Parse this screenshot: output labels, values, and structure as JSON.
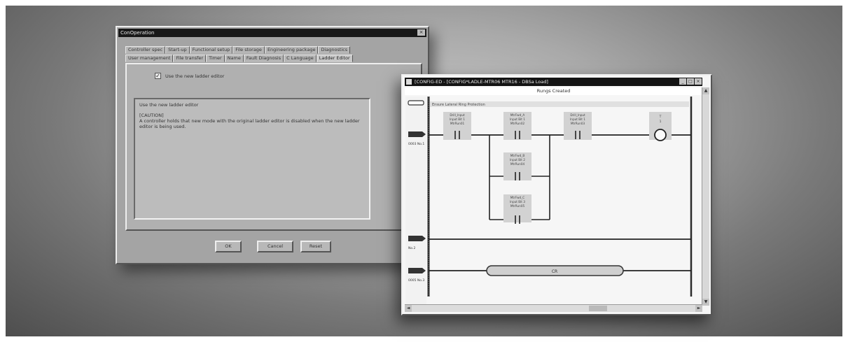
{
  "config_dialog": {
    "title": "ConOperation",
    "close_glyph": "×",
    "tabs_row1": [
      "Controller spec",
      "Start-up",
      "Functional setup",
      "File storage",
      "Engineering package",
      "Diagnostics"
    ],
    "tabs_row2": [
      "User management",
      "File transfer",
      "Timer",
      "Name",
      "Fault Diagnosis",
      "C Language",
      "Ladder Editor"
    ],
    "active_tab": "Ladder Editor",
    "checkbox": {
      "label": "Use the new ladder editor",
      "checked_glyph": "✓"
    },
    "description": {
      "heading": "Use the new ladder editor",
      "caution": "[CAUTION]",
      "body": "A controller holds that new mode with the original ladder editor is disabled when the new ladder editor is being used."
    },
    "buttons": {
      "ok": "OK",
      "cancel": "Cancel",
      "reset": "Reset"
    }
  },
  "ladder_window": {
    "title": "[CONFIG-ED - [CONFIG*LADLE-MTR06 MTR16 - DBSa Load]",
    "controls": [
      "_",
      "□",
      "×"
    ],
    "subtitle": "Rungs Created",
    "rung_comment": "Ensure Lateral Ring Protection",
    "rung_labels": [
      "0003 No.1",
      "No.2",
      "0005 No.3"
    ],
    "contact_labels": [
      [
        "Drill_Input",
        "Input Bit 1",
        "MtrRun01"
      ],
      [
        "MtrFwd_A",
        "Input Bit 1",
        "MtrRun02"
      ],
      [
        "Drill_Input",
        "Input Bit 1",
        "MtrRun03"
      ],
      [
        "MtrFwd_B",
        "Input Bit 2",
        "MtrRun04"
      ],
      [
        "MtrFwd_C",
        "Input Bit 3",
        "MtrRun05"
      ]
    ],
    "coil_label": [
      "T",
      "1"
    ],
    "function_block_label": "CR",
    "scroll_arrows": {
      "up": "▲",
      "down": "▼",
      "left": "◄",
      "right": "►"
    }
  }
}
